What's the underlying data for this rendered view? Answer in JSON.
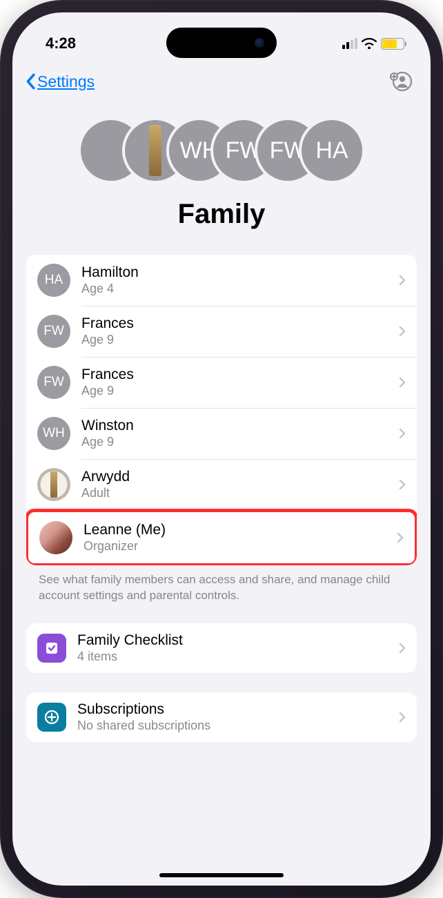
{
  "status": {
    "time": "4:28"
  },
  "nav": {
    "back_label": "Settings"
  },
  "page": {
    "title": "Family"
  },
  "header_avatars": [
    {
      "kind": "photo1"
    },
    {
      "kind": "photo2"
    },
    {
      "kind": "initials",
      "initials": "WH"
    },
    {
      "kind": "initials",
      "initials": "FW"
    },
    {
      "kind": "initials",
      "initials": "FW"
    },
    {
      "kind": "initials",
      "initials": "HA"
    }
  ],
  "members": [
    {
      "name": "Hamilton",
      "sub": "Age 4",
      "avatar": {
        "kind": "initials",
        "initials": "HA"
      },
      "highlight": false
    },
    {
      "name": "Frances",
      "sub": "Age 9",
      "avatar": {
        "kind": "initials",
        "initials": "FW"
      },
      "highlight": false
    },
    {
      "name": "Frances",
      "sub": "Age 9",
      "avatar": {
        "kind": "initials",
        "initials": "FW"
      },
      "highlight": false
    },
    {
      "name": "Winston",
      "sub": "Age 9",
      "avatar": {
        "kind": "initials",
        "initials": "WH"
      },
      "highlight": false
    },
    {
      "name": "Arwydd",
      "sub": "Adult",
      "avatar": {
        "kind": "photo2"
      },
      "highlight": false
    },
    {
      "name": "Leanne (Me)",
      "sub": "Organizer",
      "avatar": {
        "kind": "photo1"
      },
      "highlight": true
    }
  ],
  "members_footer": "See what family members can access and share, and manage child account settings and parental controls.",
  "checklist": {
    "title": "Family Checklist",
    "sub": "4 items"
  },
  "subscriptions": {
    "title": "Subscriptions",
    "sub": "No shared subscriptions"
  }
}
